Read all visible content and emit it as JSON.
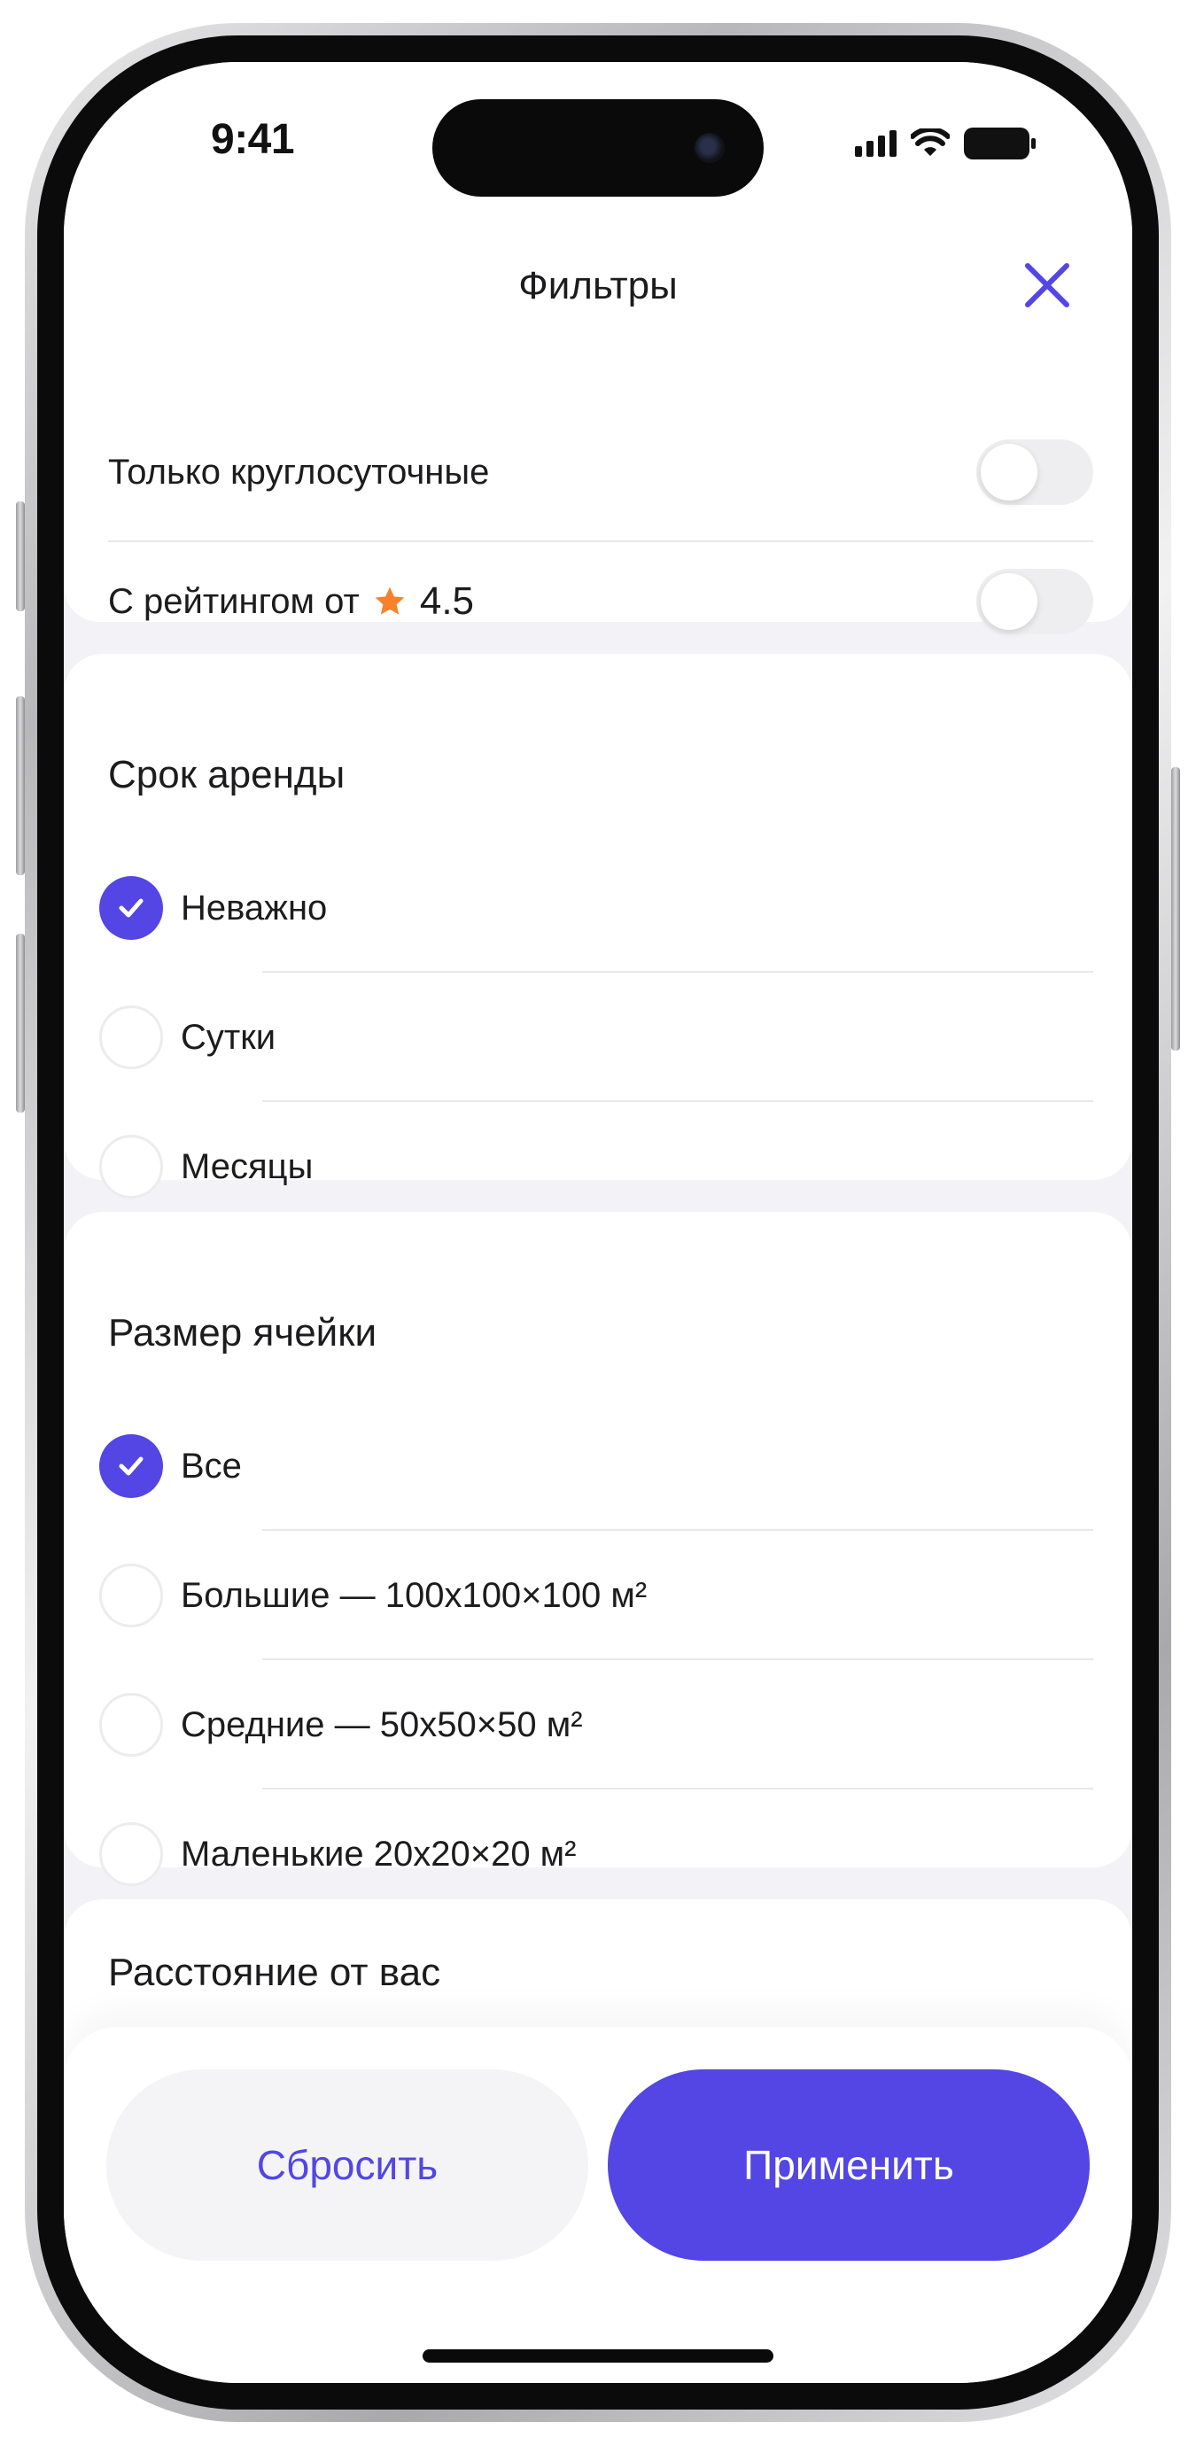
{
  "status_bar": {
    "time": "9:41"
  },
  "header": {
    "title": "Фильтры",
    "close_icon": "close-icon"
  },
  "toggles": [
    {
      "label": "Только круглосуточные",
      "on": false
    },
    {
      "label": "С рейтингом от",
      "rating": "4.5",
      "icon": "star-icon",
      "on": false
    }
  ],
  "rental": {
    "title": "Срок аренды",
    "options": [
      {
        "label": "Неважно",
        "selected": true
      },
      {
        "label": "Сутки",
        "selected": false
      },
      {
        "label": "Месяцы",
        "selected": false
      }
    ]
  },
  "size": {
    "title": "Размер ячейки",
    "options": [
      {
        "label": "Все",
        "selected": true
      },
      {
        "label": "Большие — 100х100×100 м²",
        "selected": false
      },
      {
        "label": "Средние — 50х50×50 м²",
        "selected": false
      },
      {
        "label": "Маленькие 20х20×20 м²",
        "selected": false
      }
    ]
  },
  "distance": {
    "title": "Расстояние от вас"
  },
  "actions": {
    "reset_label": "Сбросить",
    "apply_label": "Применить"
  },
  "colors": {
    "accent": "#5346e4",
    "star": "#f6822b",
    "background": "#f2f2f7"
  }
}
